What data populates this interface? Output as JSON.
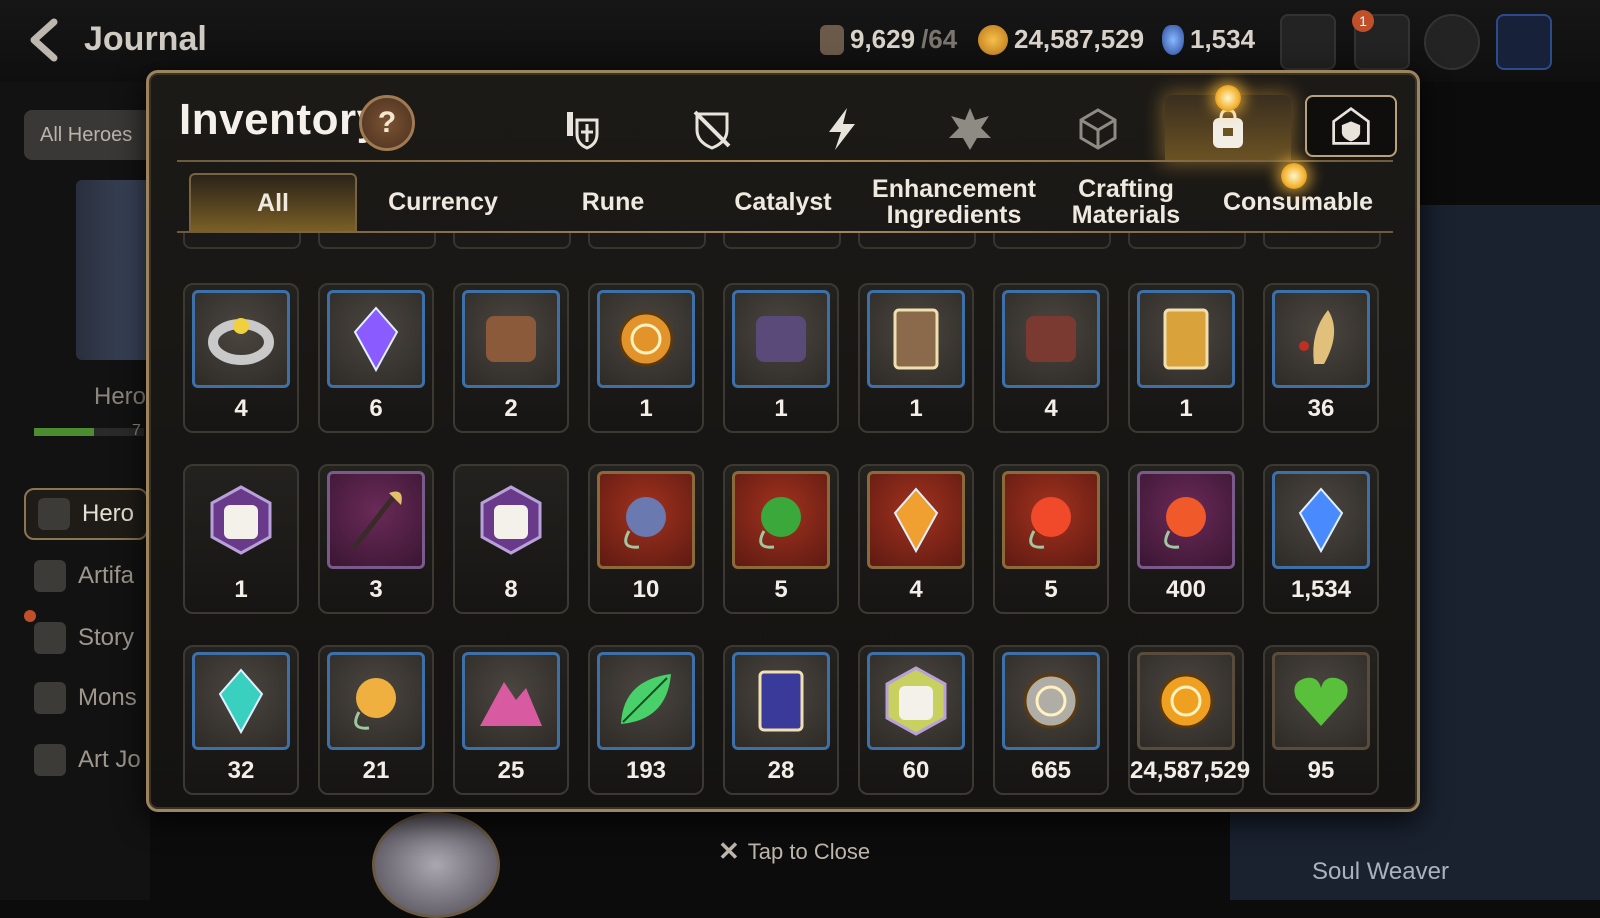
{
  "header": {
    "title": "Journal",
    "stamina": {
      "current": "9,629",
      "max": "/64"
    },
    "gold": "24,587,529",
    "skystone": "1,534",
    "mail_badge": "1"
  },
  "sidebar": {
    "all_heroes": "All Heroes",
    "hero_card_label": "Hero",
    "bar_value": "7",
    "items": [
      {
        "label": "Hero",
        "icon": "hero-icon"
      },
      {
        "label": "Artifa",
        "icon": "artifact-icon"
      },
      {
        "label": "Story",
        "icon": "story-icon"
      },
      {
        "label": "Mons",
        "icon": "monster-icon"
      },
      {
        "label": "Art Jo",
        "icon": "art-icon"
      }
    ]
  },
  "right_panel": {
    "label": "Soul Weaver"
  },
  "footer": {
    "tap_to_close": "Tap to Close"
  },
  "inventory": {
    "title": "Inventory",
    "help": "?",
    "categories": [
      {
        "name": "equipment-category-icon"
      },
      {
        "name": "no-equip-category-icon"
      },
      {
        "name": "lightning-category-icon"
      },
      {
        "name": "artifact-category-icon"
      },
      {
        "name": "material-cube-category-icon"
      },
      {
        "name": "bag-category-icon",
        "active": true
      },
      {
        "name": "storage-category-icon"
      }
    ],
    "tabs": [
      {
        "label": "All",
        "active": true
      },
      {
        "label": "Currency"
      },
      {
        "label": "Rune"
      },
      {
        "label": "Catalyst"
      },
      {
        "label": "Enhancement Ingredients"
      },
      {
        "label": "Crafting Materials"
      },
      {
        "label": "Consumable"
      }
    ],
    "items": [
      {
        "icon": "ring-icon",
        "count": "4",
        "style": "blue",
        "color": "#c9c9c9"
      },
      {
        "icon": "crystal-icon",
        "count": "6",
        "style": "blue",
        "color": "#8a5cff"
      },
      {
        "icon": "scroll-tool-icon",
        "count": "2",
        "style": "blue",
        "color": "#8a5a3a"
      },
      {
        "icon": "sun-coin-icon",
        "count": "1",
        "style": "blue",
        "color": "#e2932a"
      },
      {
        "icon": "ore-stack-icon",
        "count": "1",
        "style": "blue",
        "color": "#5a4a7a"
      },
      {
        "icon": "leather-book-icon",
        "count": "1",
        "style": "blue",
        "color": "#8a6a4a"
      },
      {
        "icon": "red-ore-icon",
        "count": "4",
        "style": "blue",
        "color": "#7a3a32"
      },
      {
        "icon": "codex-icon",
        "count": "1",
        "style": "blue",
        "color": "#d9a23a"
      },
      {
        "icon": "herb-root-icon",
        "count": "36",
        "style": "blue",
        "color": "#e0c07a"
      },
      {
        "icon": "pet-pack-icon",
        "count": "1",
        "style": "hex",
        "color": "#6a3a8a"
      },
      {
        "icon": "feather-wand-icon",
        "count": "3",
        "style": "purple",
        "color": "#e0c06a"
      },
      {
        "icon": "pet-pack-icon",
        "count": "8",
        "style": "hex",
        "color": "#6a3a8a"
      },
      {
        "icon": "blue-charm-icon",
        "count": "10",
        "style": "red",
        "color": "#6a7ab0"
      },
      {
        "icon": "clover-charm-icon",
        "count": "5",
        "style": "red",
        "color": "#3aa83a"
      },
      {
        "icon": "flame-crystal-icon",
        "count": "4",
        "style": "red",
        "color": "#f0a030"
      },
      {
        "icon": "fire-charm-icon",
        "count": "5",
        "style": "red",
        "color": "#f04a2a"
      },
      {
        "icon": "petal-charm-icon",
        "count": "400",
        "style": "purple",
        "color": "#f05a2a"
      },
      {
        "icon": "skystone-icon",
        "count": "1,534",
        "style": "blue",
        "color": "#4a8aff"
      },
      {
        "icon": "teal-crystal-icon",
        "count": "32",
        "style": "blue",
        "color": "#3ad0c0"
      },
      {
        "icon": "star-charm-icon",
        "count": "21",
        "style": "blue",
        "color": "#f0b040"
      },
      {
        "icon": "pink-mountain-icon",
        "count": "25",
        "style": "blue",
        "color": "#d85aa0"
      },
      {
        "icon": "green-leaf-icon",
        "count": "193",
        "style": "blue",
        "color": "#4ad06a"
      },
      {
        "icon": "certificate-card-icon",
        "count": "28",
        "style": "blue",
        "color": "#3a3a9a"
      },
      {
        "icon": "pet-ticket-icon",
        "count": "60",
        "style": "blue",
        "color": "#c8d060"
      },
      {
        "icon": "silver-coin-icon",
        "count": "665",
        "style": "blue",
        "color": "#b0aca6"
      },
      {
        "icon": "gold-coin-icon",
        "count": "24,587,529",
        "style": "plain",
        "color": "#f0a020"
      },
      {
        "icon": "green-heart-icon",
        "count": "95",
        "style": "plain",
        "color": "#58c03a"
      }
    ]
  }
}
